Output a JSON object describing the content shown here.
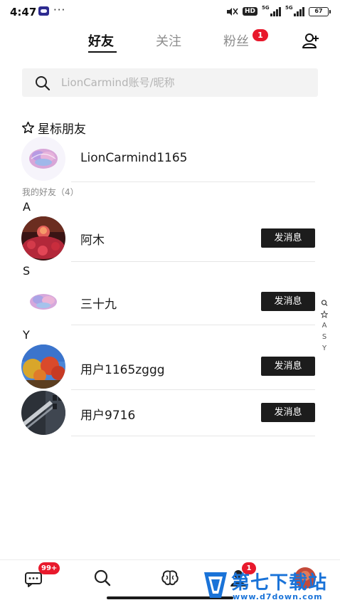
{
  "status_bar": {
    "time": "4:47",
    "dots": "···",
    "hd": "HD",
    "sim1": "5G",
    "sim2": "5G",
    "battery": "67"
  },
  "tabs": [
    {
      "label": "好友",
      "active": true
    },
    {
      "label": "关注",
      "active": false
    },
    {
      "label": "粉丝",
      "active": false,
      "badge": "1"
    }
  ],
  "search": {
    "placeholder": "LionCarmind账号/昵称",
    "value": ""
  },
  "starred": {
    "title": "星标朋友",
    "items": [
      {
        "name": "LionCarmind1165",
        "avatar": "brain-avatar"
      }
    ]
  },
  "friends": {
    "group_label": "我的好友（4）",
    "sections": [
      {
        "letter": "A",
        "items": [
          {
            "name": "阿木",
            "button": "发消息",
            "avatar": "flower-avatar"
          }
        ]
      },
      {
        "letter": "S",
        "items": [
          {
            "name": "三十九",
            "button": "发消息",
            "avatar": "brain-avatar"
          }
        ]
      },
      {
        "letter": "Y",
        "items": [
          {
            "name": "用户1165zggg",
            "button": "发消息",
            "avatar": "autumn-tree-avatar"
          },
          {
            "name": "用户9716",
            "button": "发消息",
            "avatar": "building-avatar"
          }
        ]
      }
    ]
  },
  "side_index": {
    "items": [
      "A",
      "S",
      "Y"
    ],
    "icons": [
      "search-icon",
      "star-icon"
    ]
  },
  "bottom_nav": {
    "items": [
      {
        "name": "messages",
        "icon": "chat-icon",
        "badge": "99+"
      },
      {
        "name": "search",
        "icon": "search-icon"
      },
      {
        "name": "brain",
        "icon": "brain-icon"
      },
      {
        "name": "friends",
        "icon": "person-icon",
        "badge": "1"
      },
      {
        "name": "profile",
        "icon": "avatar"
      }
    ]
  },
  "watermark": {
    "title": "第七下载站",
    "url": "www.d7down.com"
  },
  "colors": {
    "accent_badge": "#e8192c",
    "button_bg": "#1c1c1c",
    "watermark": "#1a73d8",
    "search_bg": "#f3f3f3"
  }
}
